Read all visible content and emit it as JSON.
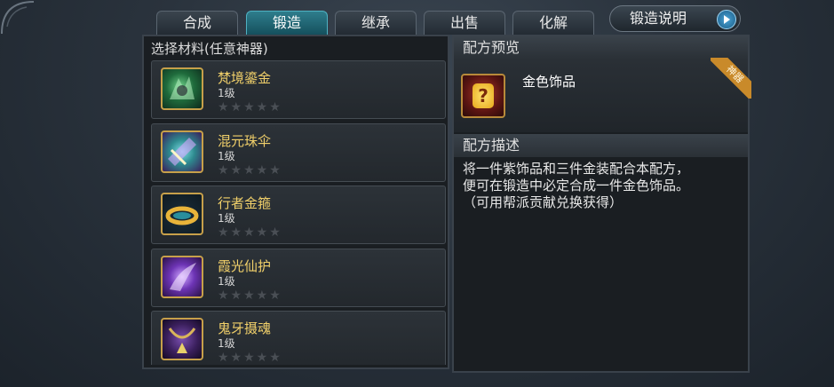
{
  "tabs": [
    {
      "label": "合成",
      "active": false
    },
    {
      "label": "锻造",
      "active": true
    },
    {
      "label": "继承",
      "active": false
    },
    {
      "label": "出售",
      "active": false
    },
    {
      "label": "化解",
      "active": false
    }
  ],
  "help_button": {
    "label": "锻造说明",
    "icon": "play-icon"
  },
  "materials": {
    "header": "选择材料(任意神器)",
    "items": [
      {
        "name": "梵境鎏金",
        "level": "1级",
        "stars": 0,
        "max_stars": 5,
        "icon": "dragon-armor-icon"
      },
      {
        "name": "混元珠伞",
        "level": "1级",
        "stars": 0,
        "max_stars": 5,
        "icon": "umbrella-weapon-icon"
      },
      {
        "name": "行者金箍",
        "level": "1级",
        "stars": 0,
        "max_stars": 5,
        "icon": "golden-circlet-icon"
      },
      {
        "name": "霞光仙护",
        "level": "1级",
        "stars": 0,
        "max_stars": 5,
        "icon": "purple-wing-icon"
      },
      {
        "name": "鬼牙摄魂",
        "level": "1级",
        "stars": 0,
        "max_stars": 5,
        "icon": "ghost-fang-necklace-icon"
      }
    ]
  },
  "recipe": {
    "preview_header": "配方预览",
    "result_name": "金色饰品",
    "result_icon": "question-mark-icon",
    "ribbon_label": "神器",
    "desc_header": "配方描述",
    "desc_lines": [
      "将一件紫饰品和三件金装配合本配方，",
      "便可在锻造中必定合成一件金色饰品。",
      "（可用帮派贡献兑换获得）"
    ]
  },
  "colors": {
    "accent": "#2f7d8c",
    "item_name": "#f1d06a",
    "ribbon": "#c98a2a"
  }
}
